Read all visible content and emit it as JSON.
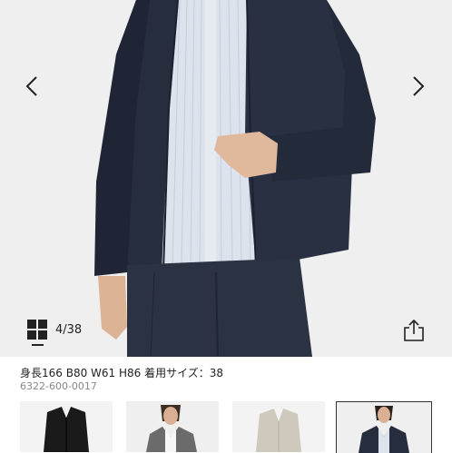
{
  "gallery": {
    "counter": "4/38",
    "icons": {
      "prev": "chevron-left-icon",
      "next": "chevron-right-icon",
      "grid": "grid-view-icon",
      "share": "share-icon"
    }
  },
  "product": {
    "model_info": "身長166 B80 W61 H86 着用サイズ：38",
    "code": "6322-600-0017"
  },
  "thumbnails": {
    "count": 4,
    "selected_index": 3
  },
  "colors": {
    "jacket_navy": "#262d3d",
    "shirt_stripe": "#d7deea",
    "background": "#efefef",
    "text": "#222222"
  }
}
